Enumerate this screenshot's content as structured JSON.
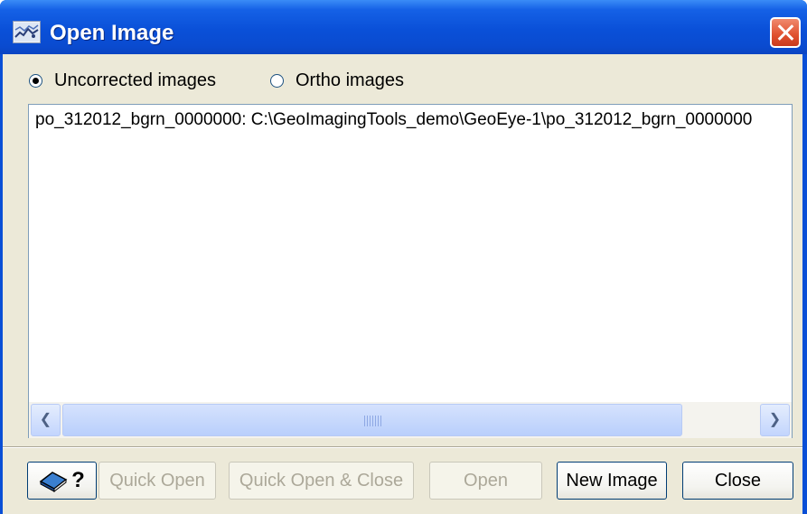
{
  "window": {
    "title": "Open Image",
    "icon": "image-app-icon",
    "close_icon": "close-icon"
  },
  "image_type": {
    "options": [
      {
        "label": "Uncorrected images",
        "selected": true
      },
      {
        "label": "Ortho images",
        "selected": false
      }
    ]
  },
  "image_list": {
    "items": [
      "po_312012_bgrn_0000000: C:\\GeoImagingTools_demo\\GeoEye-1\\po_312012_bgrn_0000000"
    ],
    "scrollbar": {
      "left_icon": "arrow-left-icon",
      "right_icon": "arrow-right-icon"
    }
  },
  "buttons": {
    "help_label": "?",
    "help_icon": "book-help-icon",
    "quick_open": "Quick Open",
    "quick_open_close": "Quick Open & Close",
    "open": "Open",
    "new_image": "New Image",
    "close": "Close"
  },
  "colors": {
    "titlebar": "#0a4fd6",
    "dialog_bg": "#ece9d8",
    "close_button": "#e0502e",
    "disabled_text": "#aca899"
  }
}
